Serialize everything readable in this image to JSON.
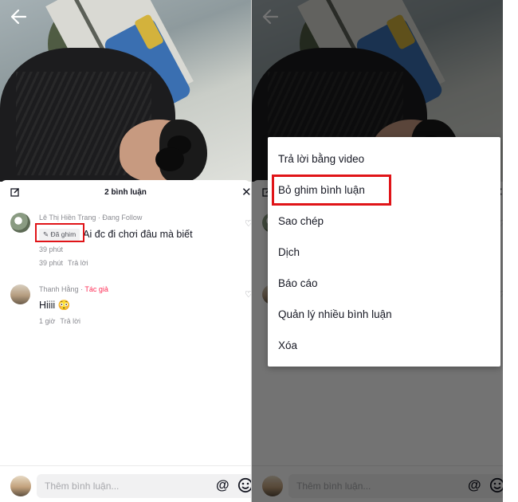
{
  "left": {
    "sheet_title": "2 bình luận",
    "comments": [
      {
        "author": "Lê Thị Hiền Trang",
        "tag": "Đang Follow",
        "pin_label": "Đã ghim",
        "text": "Ai đc đi chơi đâu mà biết",
        "time": "39 phút",
        "time2": "39 phút",
        "reply": "Trả lời"
      },
      {
        "author": "Thanh Hằng",
        "tag": "Tác giả",
        "text": "Hiiii 😳",
        "time": "1 giờ",
        "reply": "Trả lời"
      }
    ],
    "input_placeholder": "Thêm bình luận...",
    "at_symbol": "@"
  },
  "right": {
    "menu": [
      "Trả lời bằng video",
      "Bỏ ghim bình luận",
      "Sao chép",
      "Dịch",
      "Báo cáo",
      "Quản lý nhiều bình luận",
      "Xóa"
    ],
    "input_placeholder": "Thêm bình luận...",
    "at_symbol": "@"
  },
  "colors": {
    "accent": "#fe2c55",
    "highlight": "#e01418",
    "text": "#161823",
    "muted": "#8a8b91"
  },
  "icons": [
    "back-arrow-icon",
    "edit-icon",
    "close-icon",
    "heart-icon",
    "pin-icon",
    "at-icon",
    "emoji-icon"
  ]
}
